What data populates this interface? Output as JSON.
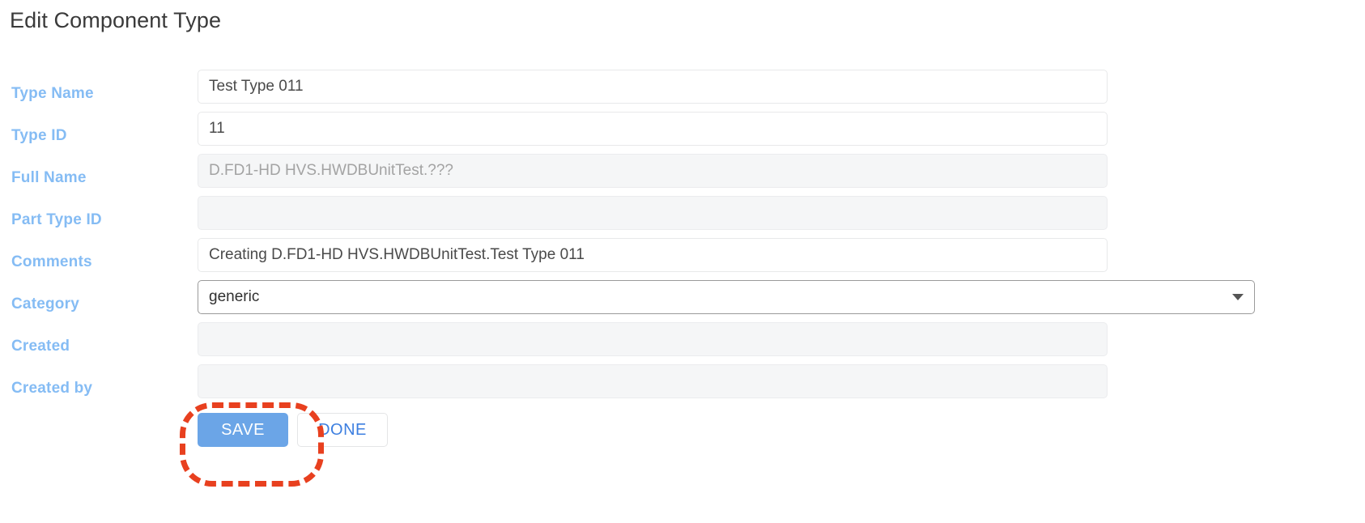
{
  "header": {
    "title": "Edit Component Type"
  },
  "form": {
    "fields": [
      {
        "label": "Type Name",
        "name": "type-name",
        "control": "text",
        "value": "Test Type 011",
        "readonly": false
      },
      {
        "label": "Type ID",
        "name": "type-id",
        "control": "text",
        "value": "11",
        "readonly": false
      },
      {
        "label": "Full Name",
        "name": "full-name",
        "control": "text",
        "value": "D.FD1-HD HVS.HWDBUnitTest.???",
        "readonly": true
      },
      {
        "label": "Part Type ID",
        "name": "part-type-id",
        "control": "text",
        "value": "",
        "readonly": true
      },
      {
        "label": "Comments",
        "name": "comments",
        "control": "text",
        "value": "Creating D.FD1-HD HVS.HWDBUnitTest.Test Type 011",
        "readonly": false
      },
      {
        "label": "Category",
        "name": "category",
        "control": "select",
        "value": "generic",
        "readonly": false
      },
      {
        "label": "Created",
        "name": "created",
        "control": "text",
        "value": "",
        "readonly": true
      },
      {
        "label": "Created by",
        "name": "created-by",
        "control": "text",
        "value": "",
        "readonly": true
      }
    ]
  },
  "actions": {
    "save_label": "SAVE",
    "done_label": "DONE"
  },
  "annotation": {
    "target": "save-button",
    "color": "#e8401f",
    "style": "dashed-rounded-rectangle"
  },
  "colors": {
    "label_blue": "#85bcf4",
    "save_blue": "#6ba5e7",
    "done_text_blue": "#3d7fe0",
    "title_gray": "#3a3a3a",
    "readonly_bg": "#f5f6f7",
    "highlight_red": "#e8401f"
  }
}
